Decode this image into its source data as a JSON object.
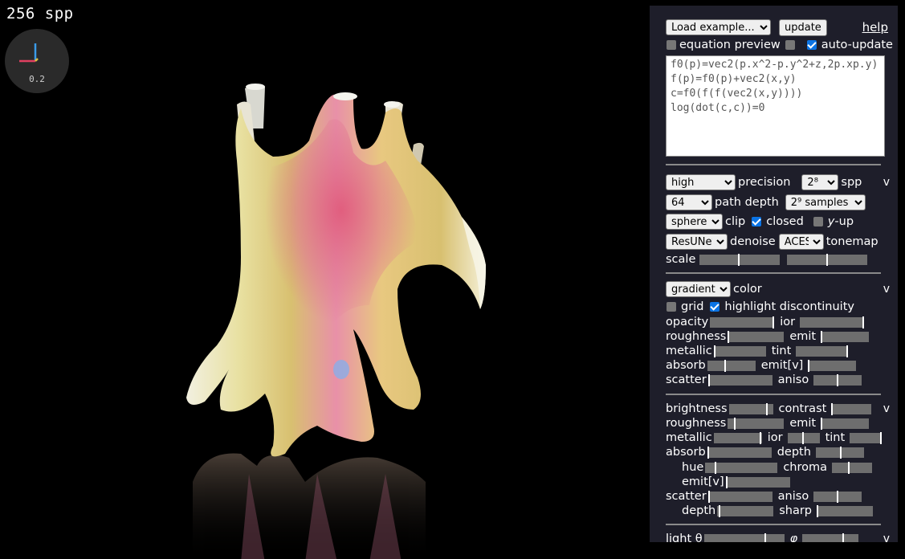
{
  "viewport": {
    "spp_label": "256 spp",
    "gizmo_scale": "0.2"
  },
  "panel": {
    "example_select": "Load example...",
    "update_button": "update",
    "help_link": "help",
    "equation_preview_label": "equation preview",
    "auto_update_label": "auto-update",
    "equation_text": "f0(p)=vec2(p.x^2-p.y^2+z,2p.xp.y)\nf(p)=f0(p)+vec2(x,y)\nc=f0(f(f(vec2(x,y))))\nlog(dot(c,c))=0",
    "render": {
      "precision_value": "high",
      "precision_label": "precision",
      "spp_value": "2⁸",
      "spp_label": "spp",
      "path_depth_value": "64",
      "path_depth_label": "path depth",
      "samples_value": "2⁹ samples",
      "clip_value": "sphere",
      "clip_label": "clip",
      "closed_label": "closed",
      "yup_label_prefix": "y",
      "yup_label_suffix": "-up",
      "denoise_value": "ResUNet",
      "denoise_label": "denoise",
      "tonemap_value": "ACES",
      "tonemap_label": "tonemap",
      "scale_label": "scale",
      "collapse": "v"
    },
    "material": {
      "color_value": "gradient",
      "color_label": "color",
      "grid_label": "grid",
      "highlight_label": "highlight discontinuity",
      "opacity": "opacity",
      "ior": "ior",
      "roughness": "roughness",
      "emit": "emit",
      "metallic": "metallic",
      "tint": "tint",
      "absorb": "absorb",
      "emitv": "emit[v]",
      "scatter": "scatter",
      "aniso": "aniso",
      "collapse": "v"
    },
    "surface": {
      "brightness": "brightness",
      "contrast": "contrast",
      "roughness": "roughness",
      "emit": "emit",
      "metallic": "metallic",
      "ior": "ior",
      "tint": "tint",
      "absorb": "absorb",
      "depth": "depth",
      "hue": "hue",
      "chroma": "chroma",
      "emitv": "emit[v]",
      "scatter": "scatter",
      "aniso": "aniso",
      "depth2": "depth",
      "sharp": "sharp",
      "collapse": "v"
    },
    "light": {
      "theta_label": "light θ",
      "phi_label": "φ",
      "collapse": "v"
    }
  },
  "colors": {
    "panel_bg": "#1e1e2a",
    "checkbox_on": "#0b74e5",
    "slider_track": "#6e6e6e"
  }
}
